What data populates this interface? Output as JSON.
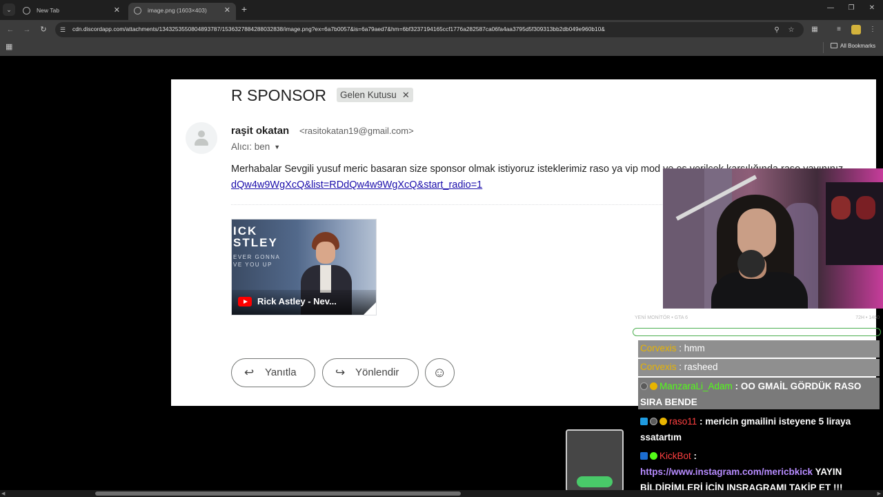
{
  "browser": {
    "tabs": [
      {
        "title": "New Tab",
        "active": false
      },
      {
        "title": "image.png (1603×403)",
        "active": true
      }
    ],
    "url": "cdn.discordapp.com/attachments/1343253550804893787/1536327884288032838/image.png?ex=6a7b0057&is=6a79aed7&hm=6bf3237194165ccf1776a282587ca06fa4aa3795d5f309313bb2db049e960b10&",
    "bookmarks_label": "All Bookmarks",
    "icons": {
      "menu": "chevron-down-icon",
      "back": "back-icon",
      "forward": "forward-icon",
      "reload": "reload-icon",
      "zoom": "zoom-icon",
      "star": "star-icon",
      "extensions": "puzzle-icon",
      "media": "media-icon",
      "more": "more-vert-icon"
    }
  },
  "email": {
    "subject": "R SPONSOR",
    "label": "Gelen Kutusu",
    "sender_name": "raşit okatan",
    "sender_email": "<rasitokatan19@gmail.com>",
    "recipient": "Alıcı: ben",
    "body_text": "Merhabalar Sevgili yusuf meric basaran size sponsor olmak istiyoruz isteklerimiz raso ya vip mod ve eş verilcek karşılığında raso yayınınız",
    "body_link": "dQw4w9WgXcQ&list=RDdQw4w9WgXcQ&start_radio=1",
    "video": {
      "title_big_line1": "ICK",
      "title_big_line2": "STLEY",
      "title_small_line1": "EVER GONNA",
      "title_small_line2": "VE YOU UP",
      "caption": "Rick Astley - Nev..."
    },
    "reply_label": "Yanıtla",
    "forward_label": "Yönlendir"
  },
  "stream": {
    "chat_header_left": "YENİ MONİTÖR • GTA 6",
    "chat_header_right": "72H • 1460",
    "messages": [
      {
        "user": "Corvexis",
        "text": ": hmm",
        "user_color": "#e8b400"
      },
      {
        "user": "Corvexis",
        "text": ": rasheed",
        "user_color": "#e8b400"
      },
      {
        "user": "ManzaraLi_Adam",
        "text": ": OO GMAİL GÖRDÜK RASO",
        "text2": "SIRA BENDE",
        "user_color": "#53fc18"
      },
      {
        "user": "raso11",
        "text": ": mericin gmailini isteyene 5 liraya",
        "text2": "ssatartım",
        "user_color": "#ff4040"
      },
      {
        "user": "KickBot",
        "text": ":",
        "link": "https://www.instagram.com/mericbkick",
        "text2": " YAYIN",
        "text3": "BİLDİRİMLERİ İÇİN INSRAGRAMI TAKİP ET !!!",
        "user_color": "#ff4040"
      }
    ]
  }
}
